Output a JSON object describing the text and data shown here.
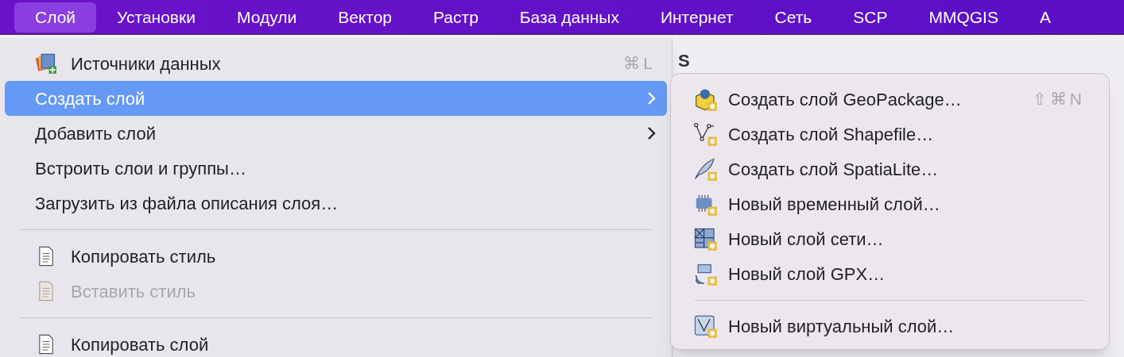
{
  "menubar": [
    {
      "label": "Слой",
      "selected": true
    },
    {
      "label": "Установки",
      "selected": false
    },
    {
      "label": "Модули",
      "selected": false
    },
    {
      "label": "Вектор",
      "selected": false
    },
    {
      "label": "Растр",
      "selected": false
    },
    {
      "label": "База данных",
      "selected": false
    },
    {
      "label": "Интернет",
      "selected": false
    },
    {
      "label": "Сеть",
      "selected": false
    },
    {
      "label": "SCP",
      "selected": false
    },
    {
      "label": "MMQGIS",
      "selected": false
    },
    {
      "label": "А",
      "selected": false
    }
  ],
  "background_text": "S",
  "menu": [
    {
      "kind": "item",
      "label": "Источники данных",
      "shortcut": "⌘L",
      "selected": false,
      "disabled": false,
      "submenu": false
    },
    {
      "kind": "item",
      "label": "Создать слой",
      "selected": true,
      "disabled": false,
      "submenu": true
    },
    {
      "kind": "item",
      "label": "Добавить слой",
      "selected": false,
      "disabled": false,
      "submenu": true
    },
    {
      "kind": "item",
      "label": "Встроить слои и группы…",
      "selected": false,
      "disabled": false,
      "submenu": false
    },
    {
      "kind": "item",
      "label": "Загрузить из файла описания слоя…",
      "selected": false,
      "disabled": false,
      "submenu": false
    },
    {
      "kind": "separator"
    },
    {
      "kind": "item",
      "label": "Копировать стиль",
      "selected": false,
      "disabled": false,
      "submenu": false
    },
    {
      "kind": "item",
      "label": "Вставить стиль",
      "selected": false,
      "disabled": true,
      "submenu": false
    },
    {
      "kind": "separator"
    },
    {
      "kind": "item",
      "label": "Копировать слой",
      "selected": false,
      "disabled": false,
      "submenu": false
    }
  ],
  "submenu": [
    {
      "kind": "item",
      "label": "Создать слой GeoPackage…",
      "shortcut": "⇧⌘N"
    },
    {
      "kind": "item",
      "label": "Создать слой Shapefile…"
    },
    {
      "kind": "item",
      "label": "Создать слой SpatiaLite…"
    },
    {
      "kind": "item",
      "label": "Новый временный слой…"
    },
    {
      "kind": "item",
      "label": "Новый слой сети…"
    },
    {
      "kind": "item",
      "label": "Новый слой GPX…"
    },
    {
      "kind": "separator"
    },
    {
      "kind": "item",
      "label": "Новый виртуальный слой…"
    }
  ]
}
